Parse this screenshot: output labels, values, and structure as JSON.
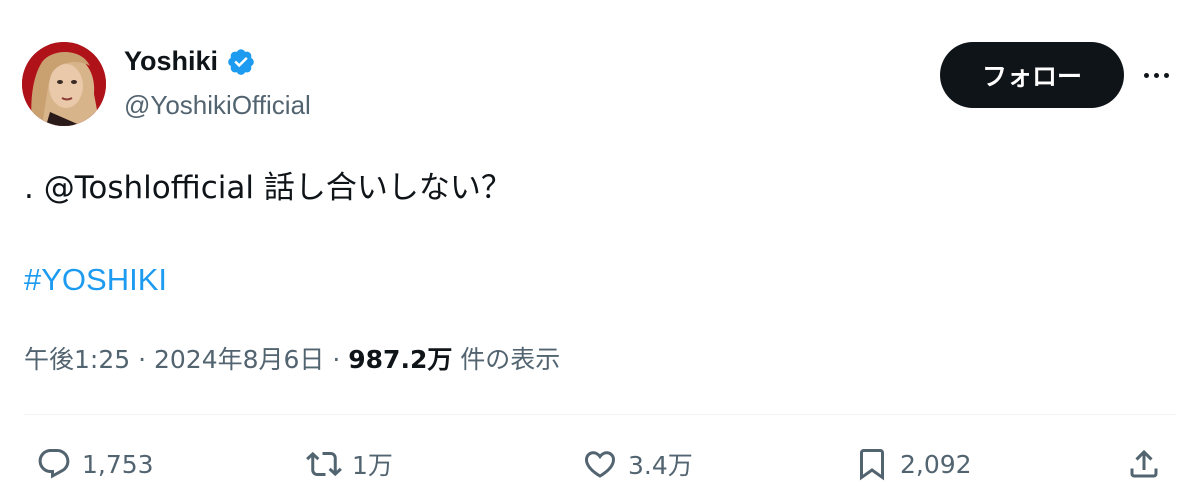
{
  "user": {
    "name": "Yoshiki",
    "handle": "@YoshikiOfficial",
    "verified": true
  },
  "follow_button_label": "フォロー",
  "tweet": {
    "prefix": ". ",
    "mention": "@Toshlofficial",
    "body": " 話し合いしない？",
    "hashtag": "#YOSHIKI"
  },
  "meta": {
    "time": "午後1:25",
    "separator1": " · ",
    "date": "2024年8月6日",
    "separator2": " · ",
    "views_count": "987.2万",
    "views_label": " 件の表示"
  },
  "actions": {
    "replies": "1,753",
    "reposts": "1万",
    "likes": "3.4万",
    "bookmarks": "2,092"
  },
  "colors": {
    "accent": "#1d9bf0",
    "text": "#0f1419",
    "secondary": "#536471",
    "button_bg": "#0f1419"
  },
  "icons": [
    "reply-icon",
    "repost-icon",
    "like-icon",
    "bookmark-icon",
    "share-icon",
    "verified-badge-icon",
    "more-icon"
  ]
}
